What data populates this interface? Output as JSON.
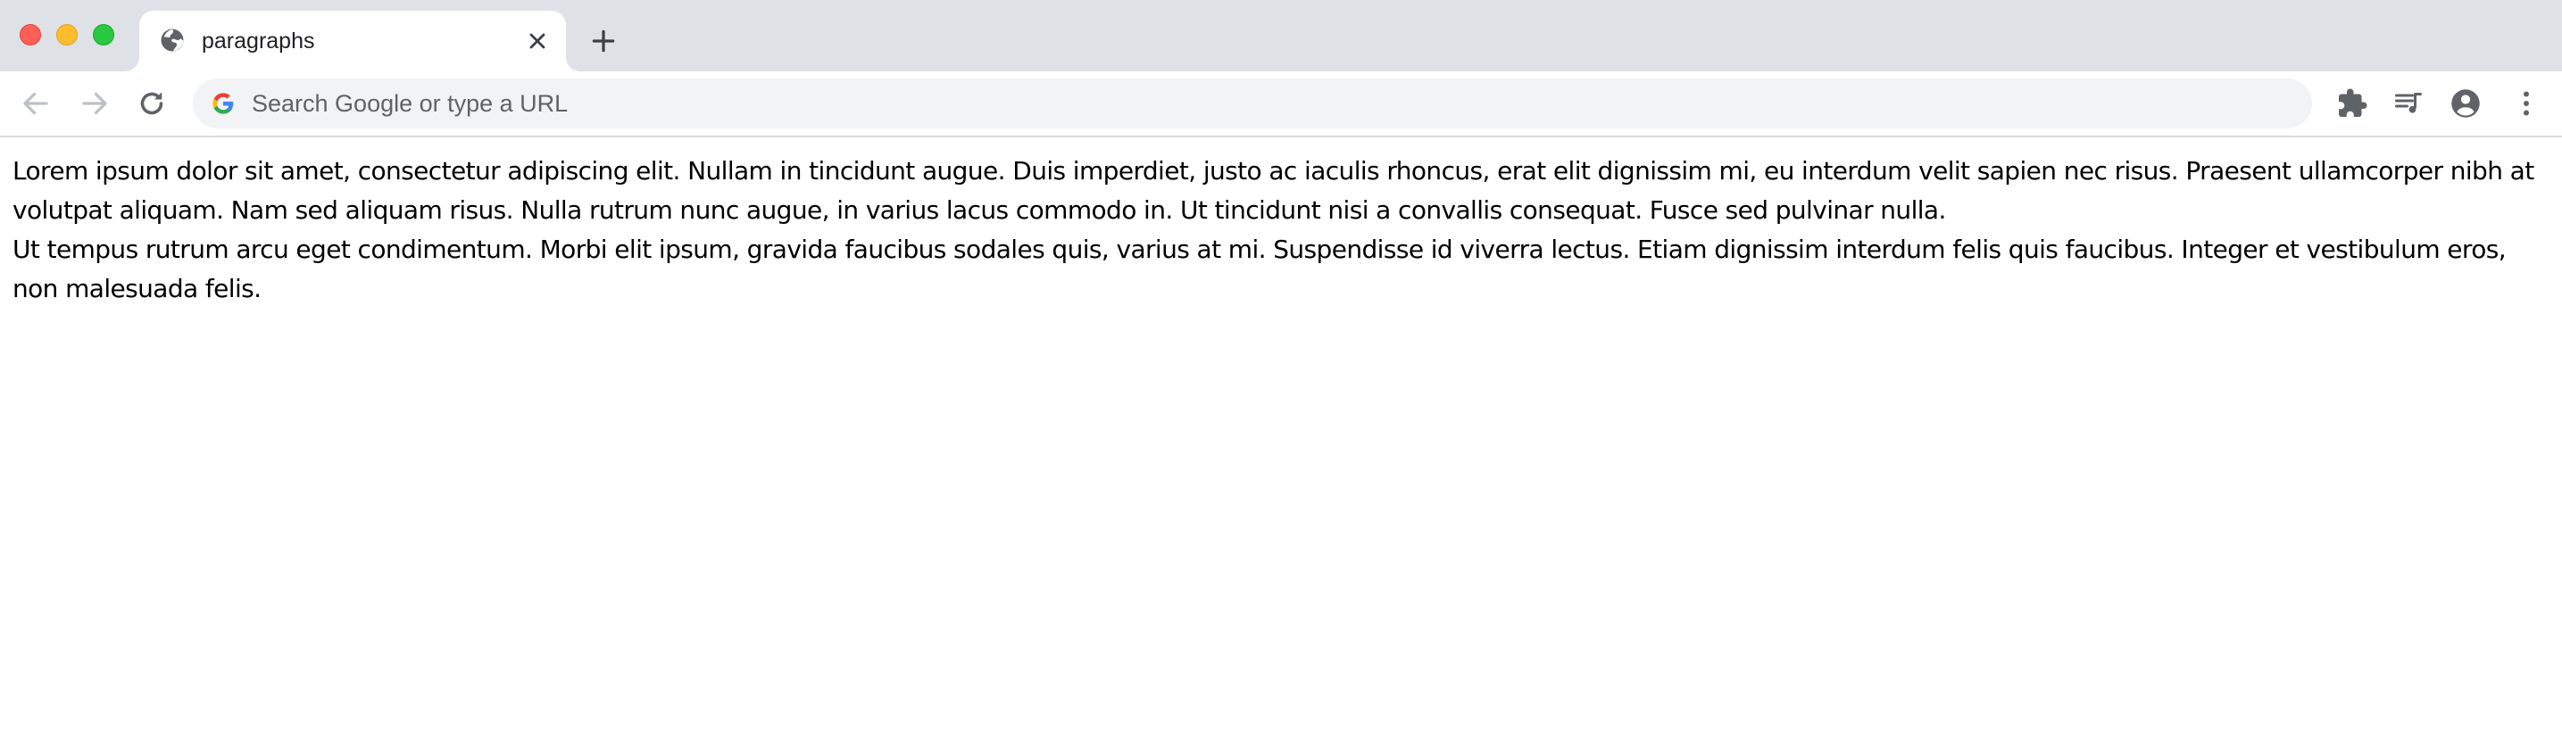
{
  "tab": {
    "title": "paragraphs",
    "favicon": "globe-icon"
  },
  "toolbar": {
    "omnibox_placeholder": "Search Google or type a URL",
    "omnibox_value": ""
  },
  "icons": {
    "back": "arrow-back-icon",
    "forward": "arrow-forward-icon",
    "reload": "reload-icon",
    "extensions": "puzzle-icon",
    "media": "media-queue-icon",
    "profile": "account-circle-icon",
    "menu": "more-vert-icon",
    "new_tab": "plus-icon",
    "close_tab": "close-icon"
  },
  "colors": {
    "tabstrip_bg": "#dee1e6",
    "omnibox_bg": "#f1f3f4",
    "traffic_close": "#fe5f57",
    "traffic_minimize": "#febc2e",
    "traffic_maximize": "#28c840"
  },
  "content": {
    "paragraphs": [
      "Lorem ipsum dolor sit amet, consectetur adipiscing elit. Nullam in tincidunt augue. Duis imperdiet, justo ac iaculis rhoncus, erat elit dignissim mi, eu interdum velit sapien nec risus. Praesent ullamcorper nibh at volutpat aliquam. Nam sed aliquam risus. Nulla rutrum nunc augue, in varius lacus commodo in. Ut tincidunt nisi a convallis consequat. Fusce sed pulvinar nulla.",
      "Ut tempus rutrum arcu eget condimentum. Morbi elit ipsum, gravida faucibus sodales quis, varius at mi. Suspendisse id viverra lectus. Etiam dignissim interdum felis quis faucibus. Integer et vestibulum eros, non malesuada felis."
    ]
  }
}
